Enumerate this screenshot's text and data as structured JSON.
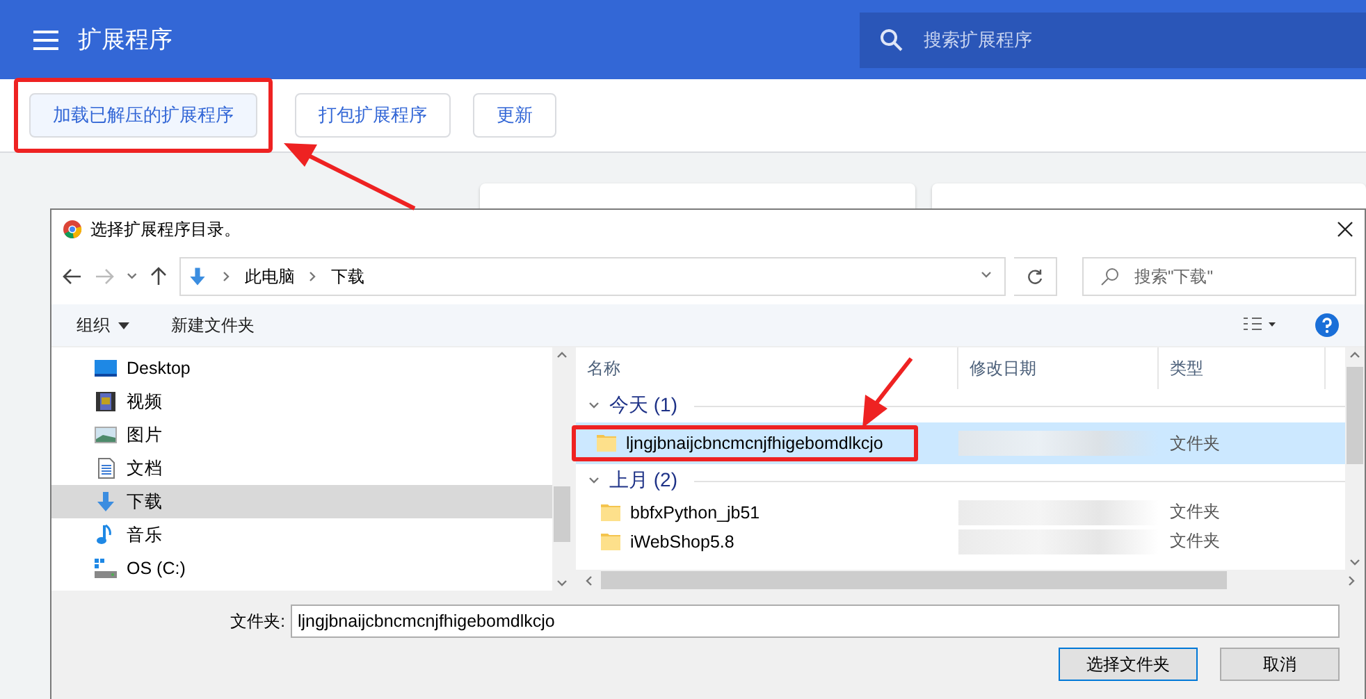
{
  "header": {
    "title": "扩展程序",
    "search_placeholder": "搜索扩展程序"
  },
  "toolbar": {
    "buttons": [
      {
        "label": "加载已解压的扩展程序",
        "highlighted": true
      },
      {
        "label": "打包扩展程序",
        "highlighted": false
      },
      {
        "label": "更新",
        "highlighted": false
      }
    ]
  },
  "dialog": {
    "title": "选择扩展程序目录。",
    "breadcrumb": [
      "此电脑",
      "下载"
    ],
    "search_placeholder": "搜索\"下载\"",
    "commands": [
      {
        "label": "组织",
        "kind": "menu"
      },
      {
        "label": "新建文件夹",
        "kind": "plain"
      }
    ],
    "nav_items": [
      {
        "label": "Desktop",
        "kind": "desktop",
        "selected": false
      },
      {
        "label": "视频",
        "kind": "video",
        "selected": false
      },
      {
        "label": "图片",
        "kind": "picture",
        "selected": false
      },
      {
        "label": "文档",
        "kind": "document",
        "selected": false
      },
      {
        "label": "下载",
        "kind": "download",
        "selected": true
      },
      {
        "label": "音乐",
        "kind": "music",
        "selected": false
      },
      {
        "label": "OS (C:)",
        "kind": "drive",
        "selected": false
      }
    ],
    "columns": [
      "名称",
      "修改日期",
      "类型"
    ],
    "groups": [
      {
        "label": "今天 (1)",
        "files": [
          {
            "name": "ljngjbnaijcbncmcnjfhigebomdlkcjo",
            "type": "文件夹",
            "selected": true,
            "highlighted": true
          }
        ]
      },
      {
        "label": "上月 (2)",
        "files": [
          {
            "name": "bbfxPython_jb51",
            "type": "文件夹",
            "selected": false,
            "highlighted": false
          },
          {
            "name": "iWebShop5.8",
            "type": "文件夹",
            "selected": false,
            "highlighted": false
          }
        ]
      }
    ],
    "folder_label": "文件夹:",
    "folder_value": "ljngjbnaijcbncmcnjfhigebomdlkcjo",
    "buttons": [
      {
        "label": "选择文件夹",
        "default": true
      },
      {
        "label": "取消",
        "default": false
      }
    ]
  }
}
